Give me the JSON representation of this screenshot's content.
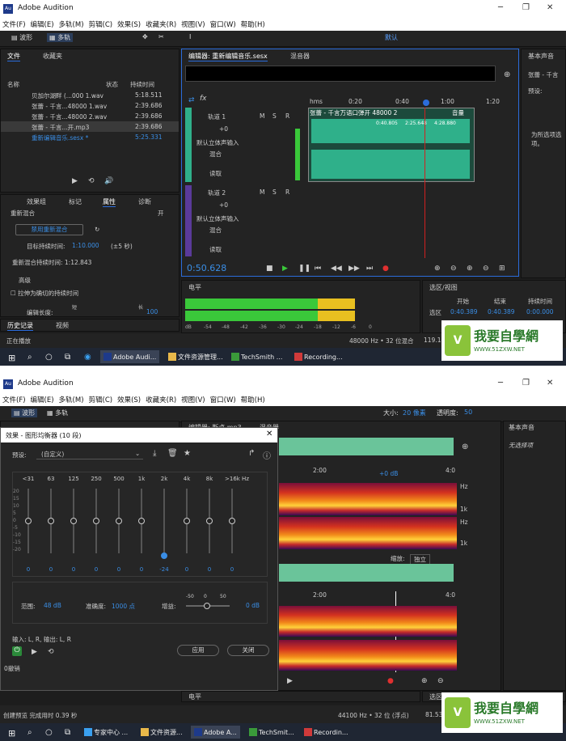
{
  "app": {
    "title": "Adobe Audition"
  },
  "menu": [
    "文件(F)",
    "编辑(E)",
    "多轨(M)",
    "剪辑(C)",
    "效果(S)",
    "收藏夹(R)",
    "视图(V)",
    "窗口(W)",
    "帮助(H)"
  ],
  "top": {
    "toolbar": {
      "waveform": "波形",
      "multitrack": "多轨",
      "workspace": "默认"
    },
    "files_panel": {
      "tabs": [
        "文件",
        "收藏夹"
      ],
      "columns": [
        "名称",
        "状态",
        "持续时间"
      ],
      "files": [
        {
          "name": "贝加尔湖畔 (...000 1.wav",
          "duration": "5:18.511"
        },
        {
          "name": "张蕾 - 千言...48000 1.wav",
          "duration": "2:39.686"
        },
        {
          "name": "张蕾 - 千言...48000 2.wav",
          "duration": "2:39.686"
        },
        {
          "name": "张蕾 - 千言...开.mp3",
          "duration": "2:39.686"
        },
        {
          "name": "重新编辑音乐.sesx *",
          "duration": "5:25.331"
        }
      ]
    },
    "props_panel": {
      "tabs": [
        "效果组",
        "标记",
        "属性",
        "诊断"
      ],
      "remix_label": "重新混合",
      "remix_state": "开",
      "disable_button": "禁用重新混合",
      "target_label": "目标持续时间:",
      "target_value": "1:10.000",
      "target_range": "(±5 秒)",
      "result_label": "重新混合持续时间: 1:12.843",
      "advanced": "高级",
      "stretch_label": "拉伸为确切的持续时间",
      "edit_length": "编辑长度:",
      "edit_short": "短",
      "edit_long": "长",
      "edit_value": "100"
    },
    "history_tabs": [
      "历史记录",
      "视频"
    ],
    "status_left": "正在播放",
    "editor": {
      "tab": "编辑器: 重新编辑音乐.sesx",
      "mixer_tab": "混音器",
      "ruler": [
        "hms",
        "0:20",
        "0:40",
        "1:00",
        "1:20"
      ],
      "track1": {
        "name": "轨道 1",
        "vol": "+0",
        "input": "默认立体声输入",
        "mix": "混合",
        "read": "读取"
      },
      "track2": {
        "name": "轨道 2",
        "vol": "+0",
        "input": "默认立体声输入",
        "mix": "混合",
        "read": "读取"
      },
      "clip_title": "张蕾 - 千言万语口弹开 48000 2",
      "clip_vol": "音量",
      "clip_markers": [
        "0:40.805",
        "2:25.648",
        "4:28.880"
      ],
      "time": "0:50.628"
    },
    "levels": {
      "title": "电平",
      "scale": [
        "dB",
        "-54",
        "-48",
        "-42",
        "-36",
        "-30",
        "-24",
        "-18",
        "-12",
        "-6",
        "0"
      ],
      "meter_fill": 0.84
    },
    "selection": {
      "title": "选区/视图",
      "headers": [
        "开始",
        "结束",
        "持续时间"
      ],
      "rows": [
        {
          "label": "选区",
          "start": "0:40.389",
          "end": "0:40.389",
          "dur": "0:00.000"
        }
      ]
    },
    "basic_sound": {
      "title": "基本声音",
      "clip": "张蕾 - 千言",
      "preset": "预设:",
      "hint": "为所选项选项。"
    },
    "status_right": "48000 Hz • 32 位混合",
    "status_extra": "119.14"
  },
  "bottom": {
    "toolbar": {
      "waveform": "波形",
      "multitrack": "多轨",
      "size_label": "大小:",
      "size_value": "20 像素",
      "opacity_label": "透明度:",
      "opacity_value": "50"
    },
    "dialog": {
      "title": "效果 - 图形均衡器 (10 段)",
      "preset_label": "预设:",
      "preset_value": "(自定义)",
      "bands": [
        "<31",
        "63",
        "125",
        "250",
        "500",
        "1k",
        "2k",
        "4k",
        "8k",
        ">16k Hz"
      ],
      "values": [
        0,
        0,
        0,
        0,
        0,
        0,
        -24,
        0,
        0,
        0
      ],
      "scale": [
        "20",
        "15",
        "10",
        "5",
        "0",
        "-5",
        "-10",
        "-15",
        "-20"
      ],
      "range_label": "范围:",
      "range_value": "48 dB",
      "accuracy_label": "准确度:",
      "accuracy_value": "1000 点",
      "gain_label": "增益:",
      "gain_scale": [
        "-50",
        "0",
        "50"
      ],
      "gain_value": "0 dB",
      "io_label": "输入: L, R,  输出: L, R",
      "apply": "应用",
      "close": "关闭"
    },
    "editor_tab": "编辑器: 断点.mp3",
    "mixer_tab": "混音器",
    "ruler_top": [
      "2:00",
      "4:0"
    ],
    "ruler_bottom": [
      "2:00",
      "4:0"
    ],
    "vol": "+0 dB",
    "hz": [
      "Hz",
      "1k",
      "Hz",
      "1k"
    ],
    "zoom_label": "缩放:",
    "zoom_value": "独立",
    "basic_sound": {
      "title": "基本声音",
      "none": "无选择项"
    },
    "levels_title": "电平",
    "selection_title": "选区/视",
    "status_left": "创建预览 完成用时 0.39 秒",
    "status_right": "44100 Hz • 32 位 (浮点)",
    "status_extra": "81.53",
    "undo": "0撤销"
  },
  "taskbar_top": [
    "Adobe Audi...",
    "文件资源管理...",
    "TechSmith ...",
    "Recording..."
  ],
  "taskbar_bottom": [
    "专家中心 ...",
    "文件资源...",
    "Adobe A...",
    "TechSmit...",
    "Recordin..."
  ],
  "watermark": {
    "text": "我要自學網",
    "url": "WWW.51ZXW.NET"
  }
}
